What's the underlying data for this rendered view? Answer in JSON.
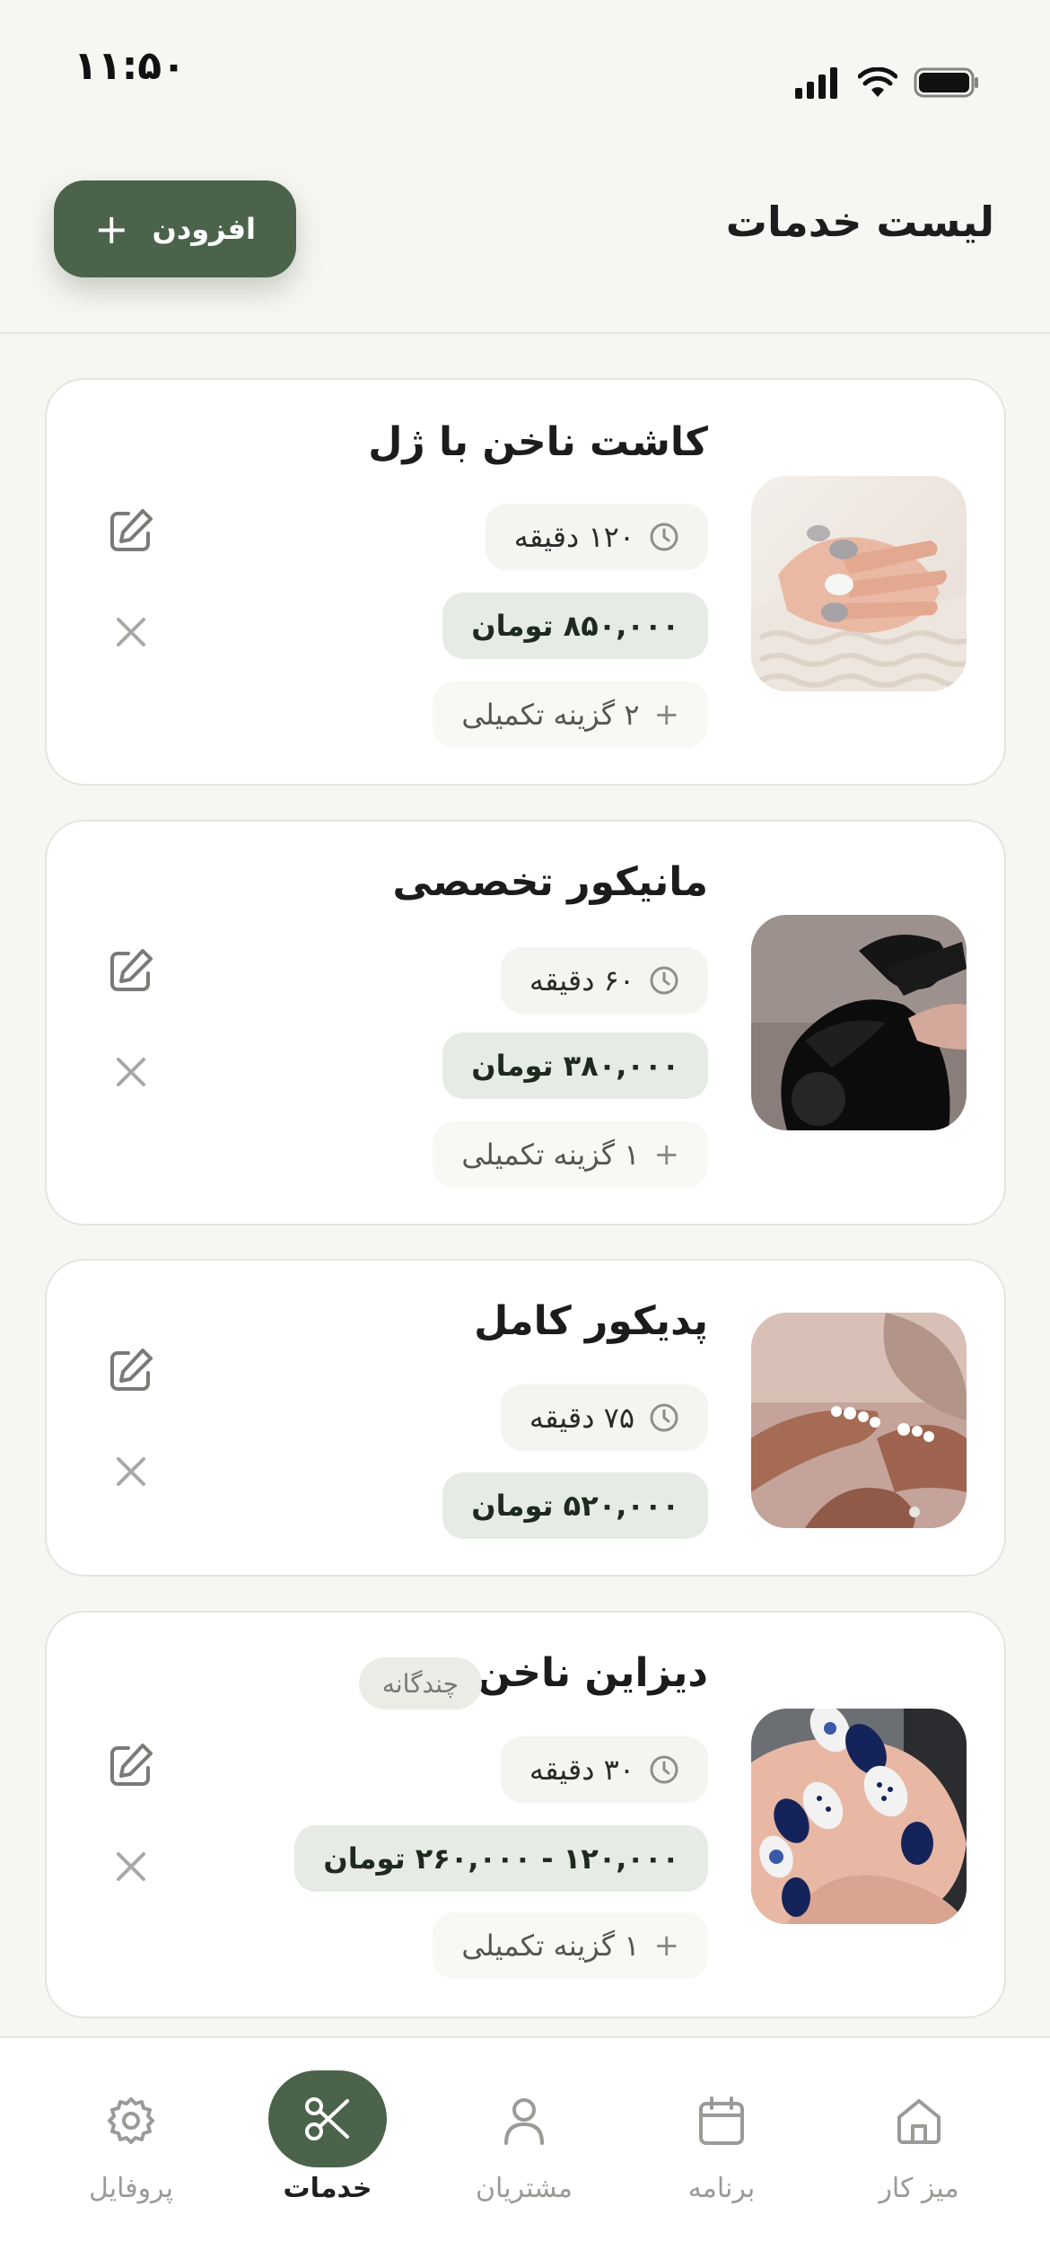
{
  "status_bar": {
    "time": "۱۱:۵۰"
  },
  "header": {
    "title": "لیست خدمات",
    "add_label": "افزودن"
  },
  "services": [
    {
      "title": "کاشت ناخن با ژل",
      "duration": "۱۲۰ دقیقه",
      "price": "۸۵۰,۰۰۰ تومان",
      "options": "۲ گزینه تکمیلی",
      "image": "gel-nails-photo"
    },
    {
      "title": "مانیکور تخصصی",
      "duration": "۶۰ دقیقه",
      "price": "۳۸۰,۰۰۰ تومان",
      "options": "۱ گزینه تکمیلی",
      "image": "manicure-photo"
    },
    {
      "title": "پدیکور کامل",
      "duration": "۷۵ دقیقه",
      "price": "۵۲۰,۰۰۰ تومان",
      "image": "pedicure-photo"
    },
    {
      "title": "دیزاین ناخن",
      "badge": "چندگانه",
      "duration": "۳۰ دقیقه",
      "price": "۱۲۰,۰۰۰ - ۲۶۰,۰۰۰ تومان",
      "options": "۱ گزینه تکمیلی",
      "image": "nail-design-photo"
    }
  ],
  "bottom_nav": [
    {
      "label": "میز کار",
      "icon": "home-icon"
    },
    {
      "label": "برنامه",
      "icon": "calendar-icon"
    },
    {
      "label": "مشتریان",
      "icon": "person-icon"
    },
    {
      "label": "خدمات",
      "icon": "scissors-icon",
      "active": true
    },
    {
      "label": "پروفایل",
      "icon": "gear-icon"
    }
  ],
  "colors": {
    "accent": "#4b634b",
    "background": "#f7f6f2",
    "price_pill": "#e7ebe5"
  }
}
